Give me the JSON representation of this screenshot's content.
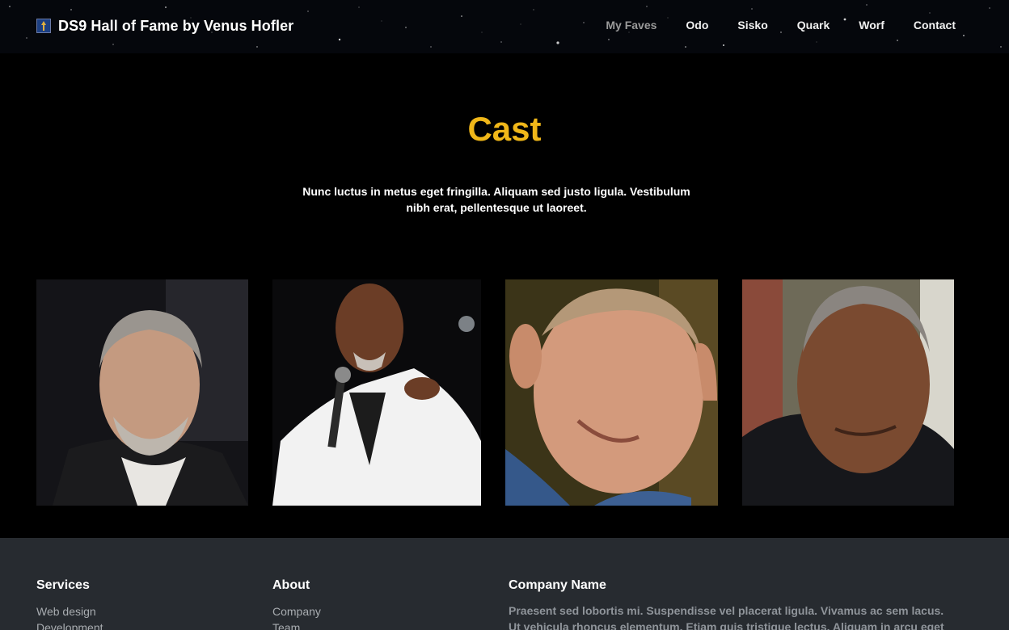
{
  "header": {
    "brand": "DS9 Hall of Fame by Venus Hofler",
    "nav": [
      "My Faves",
      "Odo",
      "Sisko",
      "Quark",
      "Worf",
      "Contact"
    ]
  },
  "main": {
    "title": "Cast",
    "lead": "Nunc luctus in metus eget fringilla. Aliquam sed justo ligula. Vestibulum nibh erat, pellentesque ut laoreet."
  },
  "colors": {
    "accent": "#f0b719",
    "footer_bg": "#272b30"
  },
  "footer": {
    "services": {
      "title": "Services",
      "items": [
        "Web design",
        "Development"
      ]
    },
    "about": {
      "title": "About",
      "items": [
        "Company",
        "Team"
      ]
    },
    "company": {
      "title": "Company Name",
      "text": "Praesent sed lobortis mi. Suspendisse vel placerat ligula. Vivamus ac sem lacus. Ut vehicula rhoncus elementum. Etiam quis tristique lectus. Aliquam in arcu eget velit"
    }
  }
}
